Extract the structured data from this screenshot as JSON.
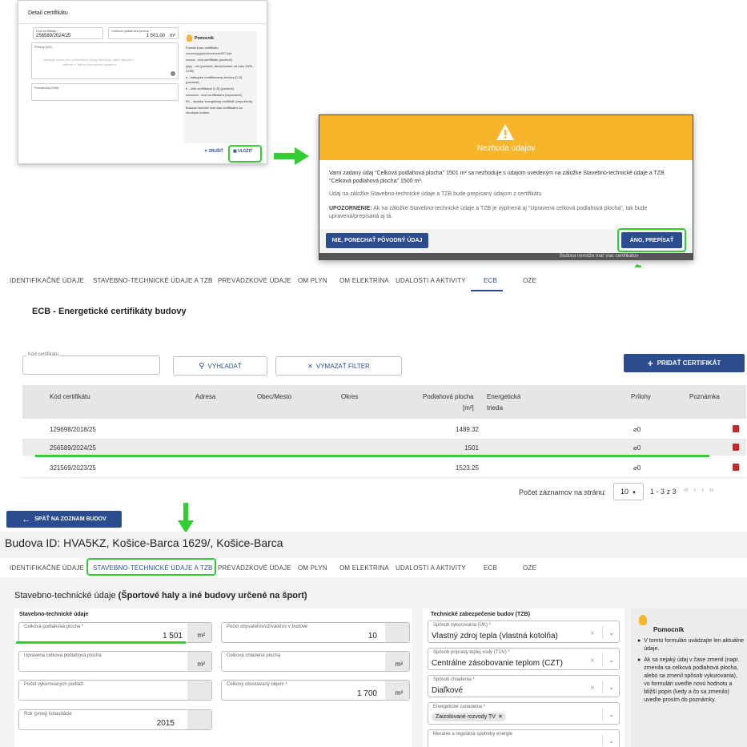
{
  "dialog1": {
    "title": "Detail certifikátu",
    "code_label": "Kód certifikátu *",
    "code_value": "256589/2024/25",
    "area_label": "Celková podlahová plocha *",
    "area_value": "1 501,00",
    "area_unit": "m²",
    "attachments_label": "Prílohy (0/5)",
    "drop_text_1": "Nahrajte súbor jeho potiahnutím (drag and drop) alebo kliknite a",
    "drop_text_2": "vyberte z Vášho súborového systému",
    "note_label": "Poznámka (0/80)",
    "help_title": "Pomocník",
    "help_intro": "Formát kódu certifikátu",
    "help_items": [
      "xxxxxx/yyyy/zz/zzzzzzzz/EC kde",
      "xxxxxx - kód certifikátu (povinné)",
      "yyyy - rok (povinné, akceptované od roku 1900 - 2199)",
      "a - kategória certifikovanej budovy [1-9] (povinné)",
      "b - účel certifikácie [1-5] (povinné)",
      "zzzzzzzz - kód certifikátora (nepovinné)",
      "EC - skratka 'energetický certifikát' (nepovinné)",
      "Budova nemôže mať viac certifikátov so zhodným kódom"
    ],
    "cancel_label": "ZRUŠIŤ",
    "save_label": "ULOŽIŤ"
  },
  "dialog2": {
    "title": "Nezhoda údajov",
    "p1": "Vami zadaný údaj \"Celková podlahová plocha\" 1501 m² sa nezhoduje s údajom uvedeným na záložke Stavebno-technické údaje a TZB \"Celková podlahová plocha\" 1500 m².",
    "p2": "Údaj na záložke Stavebno-technické údaje a TZB bude prepísaný údajom z certifikátu",
    "p3_bold": "UPOZORNENIE:",
    "p3": " Ak na záložke Stavebno-technické údaje a TZB je vyplnená aj \"Upravená celková podlahová plocha\", tak bude upravená/prepísaná aj tá.",
    "keep_label": "NIE, PONECHAŤ PÔVODNÝ ÚDAJ",
    "overwrite_label": "ÁNO, PREPÍSAŤ",
    "behind_text": "Budova nemôže mať viac certifikátov"
  },
  "tabs": [
    "IDENTIFIKAČNÉ ÚDAJE",
    "STAVEBNO-TECHNICKÉ ÚDAJE A TZB",
    "PREVÁDZKOVÉ ÚDAJE",
    "OM PLYN",
    "OM ELEKTRINA",
    "UDALOSTI A AKTIVITY",
    "ECB",
    "OZE"
  ],
  "ecb": {
    "title": "ECB - Energetické certifikáty budovy",
    "search_label": "Kód certifikátu",
    "search_button": "VYHĽADAŤ",
    "clear_button": "VYMAZAŤ FILTER",
    "add_button": "PRIDAŤ CERTIFIKÁT",
    "columns": {
      "code": "Kód certifikátu",
      "address": "Adresa",
      "city": "Obec/Mesto",
      "district": "Okres",
      "area": "Podlahová plocha",
      "area_unit": "[m²]",
      "energy1": "Energetická",
      "energy2": "trieda",
      "attachments": "Prílohy",
      "note": "Poznámka"
    },
    "rows": [
      {
        "code": "129698/2018/25",
        "area": "1489.32",
        "attachments": "0"
      },
      {
        "code": "256589/2024/25",
        "area": "1501",
        "attachments": "0"
      },
      {
        "code": "321569/2023/25",
        "area": "1523.25",
        "attachments": "0"
      }
    ],
    "per_page_label": "Počet záznamov na stránu:",
    "per_page_value": "10",
    "range": "1 - 3 z 3",
    "back_button": "SPÄŤ NA ZOZNAM BUDOV"
  },
  "building": {
    "header": "Budova ID: HVA5KZ, Košice-Barca 1629/, Košice-Barca",
    "section_prefix": "Stavebno-technické údaje ",
    "section_bold": "(Športové haly a iné budovy určené na šport)",
    "group1": "Stavebno-technické údaje",
    "group2": "Technické zabezpečenie budov (TZB)",
    "fields": {
      "total_area_label": "Celková podlahová plocha *",
      "total_area_value": "1 501",
      "unit": "m²",
      "occupants_label": "Počet obyvateľov/užívateľov v budove",
      "occupants_value": "10",
      "adj_area_label": "Upravená celková podlahová plocha",
      "cooled_label": "Celková chladená plocha",
      "floors_label": "Počet vykurovaných podlaží",
      "volume_label": "Celkový obostavaný objem *",
      "volume_value": "1 700",
      "volume_unit": "m³",
      "year_label": "Rok (prvej) kolaudácie",
      "year_value": "2015",
      "heating_label": "Spôsob vykurovania (ÚK) *",
      "heating_value": "Vlastný zdroj tepla (vlastná kotolňa)",
      "water_label": "Spôsob prípravy teplej vody (TÚV) *",
      "water_value": "Centrálne zásobovanie teplom (CZT)",
      "cooling_label": "Spôsob chladenia *",
      "cooling_value": "Diaľkové",
      "energy_label": "Energetické zariadenia *",
      "energy_chip": "Zaizolované rozvody TV",
      "measure_label": "Meranie a regulácia spotreby energie"
    },
    "help_title": "Pomocník",
    "help_items": [
      "V tomto formulári uvádzajte len aktuálne údaje.",
      "Ak sa nejaký údaj v čase zmenil (napr. zmenila sa celková podlahová plocha, alebo sa zmenil spôsob vykurovania), vo formulári uveďte novú hodnotu a bližší popis (kedy a čo sa zmenilo) uveďte prosím do poznámky."
    ]
  },
  "colors": {
    "primary": "#2b4c8f",
    "warning": "#f6b52a",
    "highlight": "#33cc33",
    "danger": "#c62828"
  }
}
